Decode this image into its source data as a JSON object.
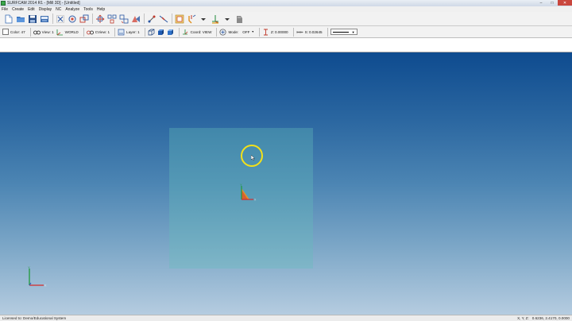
{
  "window": {
    "title": "SURFCAM 2014 R1 - [Mill 3D] - [Untitled]",
    "minimize": "–",
    "maximize": "□",
    "close": "✕"
  },
  "menu": [
    "File",
    "Create",
    "Edit",
    "Display",
    "NC",
    "Analyze",
    "Tools",
    "Help"
  ],
  "toolbar2": {
    "color_label": "Color: 47",
    "view_label": "View: 1",
    "world_label": "WORLD",
    "cview_label": "CView: 1",
    "layer_label": "Layer: 1",
    "coordview_label": "Coord: VIEW",
    "mode_label": "Mode:",
    "mode_value": "OFF",
    "z_label": "Z:",
    "z_value": "0.00000",
    "s_label": "S:",
    "s_value": "0.02645"
  },
  "viewport": {
    "background_top": "#0e4b8f",
    "background_bottom": "#b5cce0",
    "stock_color": "#64beb9",
    "cursor_ring_color": "#f3e11a",
    "origin_axis_labels": {
      "x": "X",
      "y": "Y"
    },
    "world_axis_labels": {
      "x": "X",
      "y": "Y"
    }
  },
  "status": {
    "license": "Licensed to: Demo/Educational System",
    "coord_label": "X, Y, Z:",
    "coord_value": "0.6236, 2.4170, 0.0000"
  }
}
